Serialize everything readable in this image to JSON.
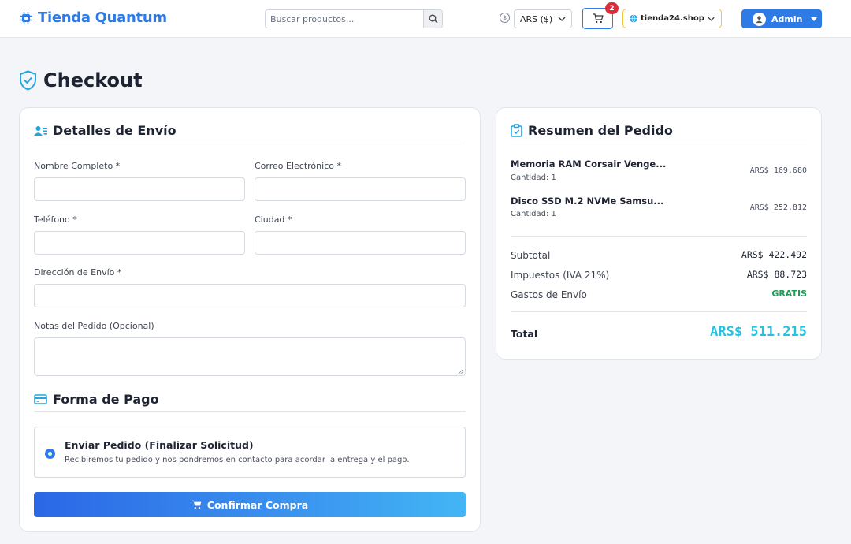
{
  "header": {
    "brand": "Tienda Quantum",
    "search_placeholder": "Buscar productos...",
    "currency": "ARS ($)",
    "cart_count": "2",
    "store": "tienda24.shop",
    "user": "Admin"
  },
  "page": {
    "title": "Checkout"
  },
  "shipping": {
    "title": "Detalles de Envío",
    "fields": {
      "name": "Nombre Completo *",
      "email": "Correo Electrónico *",
      "phone": "Teléfono *",
      "city": "Ciudad *",
      "address": "Dirección de Envío *",
      "notes": "Notas del Pedido (Opcional)"
    }
  },
  "payment": {
    "title": "Forma de Pago",
    "option_title": "Enviar Pedido (Finalizar Solicitud)",
    "option_desc": "Recibiremos tu pedido y nos pondremos en contacto para acordar la entrega y el pago.",
    "selected": true,
    "confirm": "Confirmar Compra"
  },
  "summary": {
    "title": "Resumen del Pedido",
    "items": [
      {
        "name": "Memoria RAM Corsair Venge...",
        "qty": "Cantidad: 1",
        "price": "ARS$ 169.680"
      },
      {
        "name": "Disco SSD M.2 NVMe Samsu...",
        "qty": "Cantidad: 1",
        "price": "ARS$ 252.812"
      }
    ],
    "subtotal_label": "Subtotal",
    "subtotal": "ARS$ 422.492",
    "tax_label": "Impuestos (IVA 21%)",
    "tax": "ARS$ 88.723",
    "shipping_label": "Gastos de Envío",
    "shipping": "GRATIS",
    "total_label": "Total",
    "total": "ARS$ 511.215"
  },
  "colors": {
    "primary": "#2e7be8",
    "accent": "#22c3e0",
    "success": "#1f9d55",
    "badge": "#dc2c3c",
    "store_border": "#f3c43f"
  }
}
